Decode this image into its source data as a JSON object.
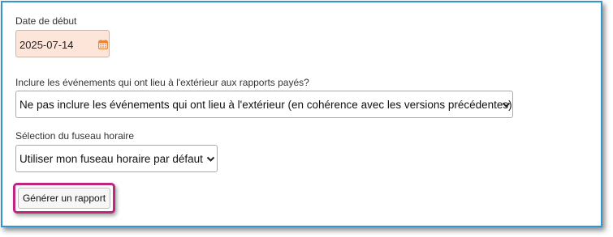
{
  "form": {
    "start_date": {
      "label": "Date de début",
      "value": "2025-07-14",
      "icon": "calendar-icon",
      "background": "#fde5d9"
    },
    "outdoor_events": {
      "label": "Inclure les événements qui ont lieu à l'extérieur aux rapports payés?",
      "selected": "Ne pas inclure les événements qui ont lieu à l'extérieur (en cohérence avec les versions précédentes)"
    },
    "timezone": {
      "label": "Sélection du fuseau horaire",
      "selected": "Utiliser mon fuseau horaire par défaut"
    },
    "generate_button": {
      "label": "Générer un rapport",
      "highlight_color": "#c0267f"
    }
  },
  "colors": {
    "frame_border": "#2f96d3",
    "calendar_icon": "#e8893a"
  }
}
